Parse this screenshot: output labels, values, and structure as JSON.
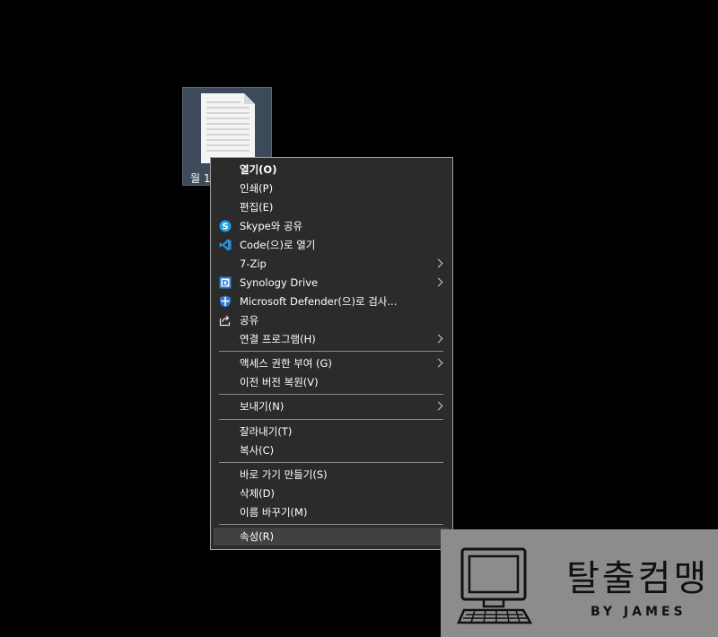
{
  "desktop": {
    "file_icon": {
      "label": "월 1"
    }
  },
  "menu": {
    "items": [
      {
        "label": "열기(O)",
        "icon": ""
      },
      {
        "label": "인쇄(P)",
        "icon": ""
      },
      {
        "label": "편집(E)",
        "icon": ""
      },
      {
        "label": "Skype와 공유",
        "icon": "skype-icon"
      },
      {
        "label": "Code(으)로 열기",
        "icon": "vscode-icon"
      },
      {
        "label": "7-Zip",
        "icon": "",
        "submenu": true
      },
      {
        "label": "Synology Drive",
        "icon": "synology-drive-icon",
        "submenu": true
      },
      {
        "label": "Microsoft Defender(으)로 검사...",
        "icon": "defender-shield-icon"
      },
      {
        "label": "공유",
        "icon": "share-icon"
      },
      {
        "label": "연결 프로그램(H)",
        "icon": "",
        "submenu": true
      },
      {
        "label": "액세스 권한 부여 (G)",
        "icon": "",
        "submenu": true
      },
      {
        "label": "이전 버전 복원(V)",
        "icon": ""
      },
      {
        "label": "보내기(N)",
        "icon": "",
        "submenu": true
      },
      {
        "label": "잘라내기(T)",
        "icon": ""
      },
      {
        "label": "복사(C)",
        "icon": ""
      },
      {
        "label": "바로 가기 만들기(S)",
        "icon": ""
      },
      {
        "label": "삭제(D)",
        "icon": ""
      },
      {
        "label": "이름 바꾸기(M)",
        "icon": ""
      },
      {
        "label": "속성(R)",
        "icon": ""
      }
    ]
  },
  "watermark": {
    "title": "탈출컴맹",
    "subtitle": "BY JAMES",
    "icon": "computer-monitor-icon"
  },
  "colors": {
    "menu_bg": "#2b2b2b",
    "hover_bg": "#414141",
    "skype": "#1aa0e6",
    "vscode": "#2a8fd8",
    "synology": "#2c7fd1",
    "defender": "#2f79c8"
  }
}
